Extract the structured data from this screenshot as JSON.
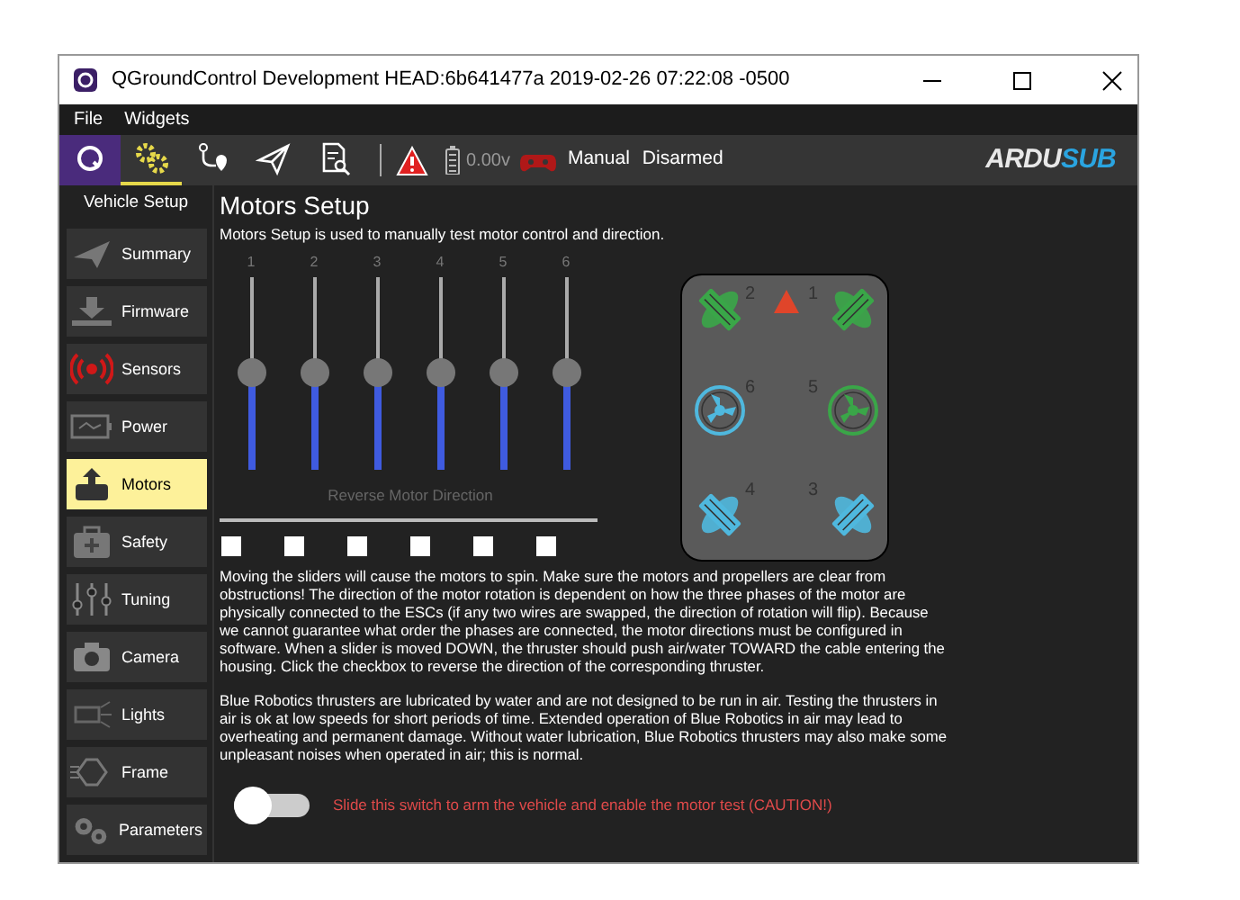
{
  "window": {
    "title": "QGroundControl Development HEAD:6b641477a 2019-02-26 07:22:08 -0500"
  },
  "menu": [
    "File",
    "Widgets"
  ],
  "toolbar": {
    "tools": [
      {
        "selected": false
      },
      {
        "selected": true
      },
      {
        "selected": false
      },
      {
        "selected": false
      },
      {
        "selected": false
      }
    ],
    "battery": "0.00v",
    "flight_mode": "Manual",
    "arm_state": "Disarmed",
    "logo": [
      "ARDU",
      "SUB"
    ]
  },
  "sidebar": {
    "title": "Vehicle Setup",
    "items": [
      {
        "label": "Summary",
        "selected": false
      },
      {
        "label": "Firmware",
        "selected": false
      },
      {
        "label": "Sensors",
        "selected": false
      },
      {
        "label": "Power",
        "selected": false
      },
      {
        "label": "Motors",
        "selected": true
      },
      {
        "label": "Safety",
        "selected": false
      },
      {
        "label": "Tuning",
        "selected": false
      },
      {
        "label": "Camera",
        "selected": false
      },
      {
        "label": "Lights",
        "selected": false
      },
      {
        "label": "Frame",
        "selected": false
      },
      {
        "label": "Parameters",
        "selected": false
      }
    ]
  },
  "page": {
    "title": "Motors Setup",
    "subtitle": "Motors Setup is used to manually test motor control and direction.",
    "sliders": [
      {
        "label": "1",
        "level": 0.5
      },
      {
        "label": "2",
        "level": 0.5
      },
      {
        "label": "3",
        "level": 0.5
      },
      {
        "label": "4",
        "level": 0.5
      },
      {
        "label": "5",
        "level": 0.5
      },
      {
        "label": "6",
        "level": 0.5
      }
    ],
    "reverse_label": "Reverse Motor Direction",
    "reverse_checkboxes": [
      {
        "checked": false
      },
      {
        "checked": false
      },
      {
        "checked": false
      },
      {
        "checked": false
      },
      {
        "checked": false
      },
      {
        "checked": false
      }
    ],
    "frame_motors": [
      {
        "label": "2",
        "kind": "vectored",
        "color": "#3aa648"
      },
      {
        "label": "1",
        "kind": "vectored",
        "color": "#3aa648"
      },
      {
        "label": "6",
        "kind": "vertical",
        "color": "#4fb8de"
      },
      {
        "label": "5",
        "kind": "vertical",
        "color": "#3aa648"
      },
      {
        "label": "4",
        "kind": "vectored",
        "color": "#4fb8de"
      },
      {
        "label": "3",
        "kind": "vectored",
        "color": "#4fb8de"
      }
    ],
    "paragraphs": [
      "Moving the sliders will cause the motors to spin. Make sure the motors and propellers are clear from obstructions! The direction of the motor rotation is dependent on how the three phases of the motor are physically connected to the ESCs (if any two wires are swapped, the direction of rotation will flip). Because we cannot guarantee what order the phases are connected, the motor directions must be configured in software. When a slider is moved DOWN, the thruster should push air/water TOWARD the cable entering the housing. Click the checkbox to reverse the direction of the corresponding thruster.",
      "Blue Robotics thrusters are lubricated by water and are not designed to be run in air. Testing the thrusters in air is ok at low speeds for short periods of time. Extended operation of Blue Robotics in air may lead to overheating and permanent damage. Without water lubrication, Blue Robotics thrusters may also make some unpleasant noises when operated in air; this is normal."
    ],
    "arm_switch": {
      "on": false,
      "label": "Slide this switch to arm the vehicle and enable the motor test (CAUTION!)"
    }
  }
}
